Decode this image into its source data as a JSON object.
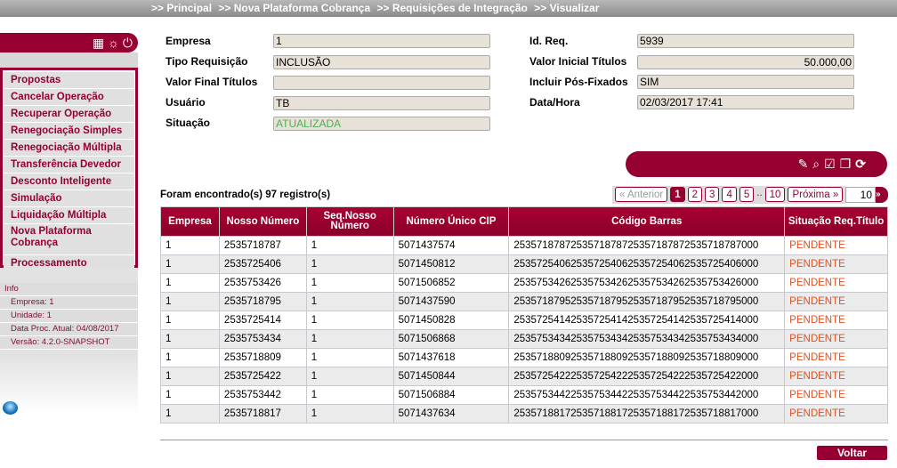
{
  "breadcrumb": [
    ">> Principal",
    ">> Nova Plataforma Cobrança",
    ">> Requisições de Integração",
    ">> Visualizar"
  ],
  "sidebar": {
    "icons": [
      "calculator-icon",
      "settings-icon",
      "power-icon"
    ],
    "menu": [
      "Propostas",
      "Cancelar Operação",
      "Recuperar Operação",
      "Renegociação Simples",
      "Renegociação Múltipla",
      "Transferência Devedor",
      "Desconto Inteligente",
      "Simulação",
      "Liquidação Múltipla",
      "Nova Plataforma Cobrança",
      "Processamento"
    ],
    "info": {
      "title": "Info",
      "empresa": "Empresa: 1",
      "unidade": "Unidade: 1",
      "data": "Data Proc. Atual: 04/08/2017",
      "versao": "Versão: 4.2.0-SNAPSHOT"
    }
  },
  "form": {
    "empresa": {
      "label": "Empresa",
      "value": "1"
    },
    "tipo": {
      "label": "Tipo Requisição",
      "value": "INCLUSÃO"
    },
    "valor_final": {
      "label": "Valor Final Títulos",
      "value": ""
    },
    "usuario": {
      "label": "Usuário",
      "value": "TB"
    },
    "situacao": {
      "label": "Situação",
      "value": "ATUALIZADA"
    },
    "id_req": {
      "label": "Id. Req.",
      "value": "5939"
    },
    "valor_inicial": {
      "label": "Valor Inicial Títulos",
      "value": "50.000,00"
    },
    "incluir": {
      "label": "Incluir Pós-Fixados",
      "value": "SIM"
    },
    "data_hora": {
      "label": "Data/Hora",
      "value": "02/03/2017 17:41"
    }
  },
  "toolbar_icons": [
    "edit-icon",
    "search-document-icon",
    "checkbox-icon",
    "copy-icon",
    "refresh-icon"
  ],
  "results": {
    "found": "Foram encontrado(s) 97 registro(s)"
  },
  "pager": {
    "prev": "« Anterior",
    "pages": [
      "1",
      "2",
      "3",
      "4",
      "5"
    ],
    "dots": "..",
    "last": "10",
    "next": "Próxima »",
    "page_size": "10",
    "go": "»"
  },
  "table": {
    "headers": [
      "Empresa",
      "Nosso Número",
      "Seq.Nosso Número",
      "Número Único CIP",
      "Código Barras",
      "Situação Req.Título"
    ],
    "rows": [
      [
        "1",
        "2535718787",
        "1",
        "5071437574",
        "2535718787253571878725357187872535718787000",
        "PENDENTE"
      ],
      [
        "1",
        "2535725406",
        "1",
        "5071450812",
        "2535725406253572540625357254062535725406000",
        "PENDENTE"
      ],
      [
        "1",
        "2535753426",
        "1",
        "5071506852",
        "2535753426253575342625357534262535753426000",
        "PENDENTE"
      ],
      [
        "1",
        "2535718795",
        "1",
        "5071437590",
        "2535718795253571879525357187952535718795000",
        "PENDENTE"
      ],
      [
        "1",
        "2535725414",
        "1",
        "5071450828",
        "2535725414253572541425357254142535725414000",
        "PENDENTE"
      ],
      [
        "1",
        "2535753434",
        "1",
        "5071506868",
        "2535753434253575343425357534342535753434000",
        "PENDENTE"
      ],
      [
        "1",
        "2535718809",
        "1",
        "5071437618",
        "2535718809253571880925357188092535718809000",
        "PENDENTE"
      ],
      [
        "1",
        "2535725422",
        "1",
        "5071450844",
        "2535725422253572542225357254222535725422000",
        "PENDENTE"
      ],
      [
        "1",
        "2535753442",
        "1",
        "5071506884",
        "2535753442253575344225357534422535753442000",
        "PENDENTE"
      ],
      [
        "1",
        "2535718817",
        "1",
        "5071437634",
        "2535718817253571881725357188172535718817000",
        "PENDENTE"
      ]
    ]
  },
  "voltar": "Voltar"
}
